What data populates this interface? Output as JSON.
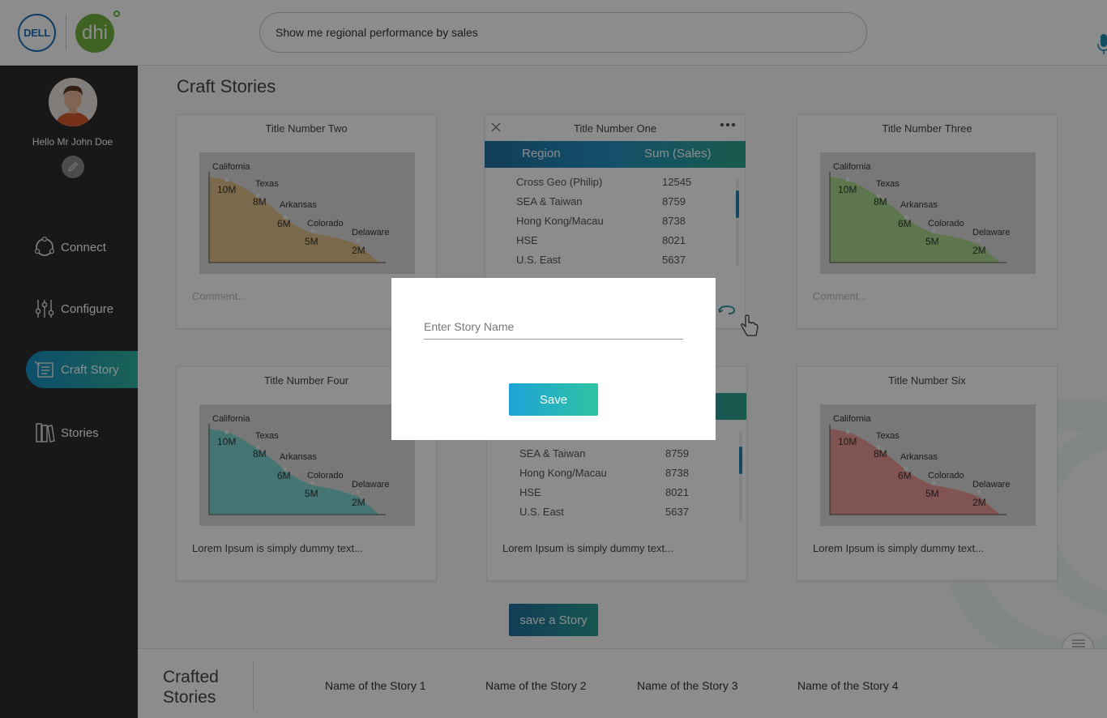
{
  "header": {
    "logos": {
      "dell": "DELL",
      "dhi": "dhi"
    },
    "search": {
      "value": "Show me regional performance by sales",
      "icon": "mic-icon"
    }
  },
  "sidebar": {
    "greeting": "Hello Mr John Doe",
    "nav": [
      {
        "label": "Connect",
        "icon": "connect-icon",
        "active": false
      },
      {
        "label": "Configure",
        "icon": "sliders-icon",
        "active": false
      },
      {
        "label": "Craft Story",
        "icon": "craft-story-icon",
        "active": true
      },
      {
        "label": "Stories",
        "icon": "books-icon",
        "active": false
      }
    ]
  },
  "main": {
    "title": "Craft Stories",
    "chart_labels": {
      "c1": "California",
      "c2": "Texas",
      "c3": "Arkansas",
      "c4": "Colorado",
      "c5": "Delaware",
      "v1": "10M",
      "v2": "8M",
      "v3": "6M",
      "v4": "5M",
      "v5": "2M"
    },
    "cards": [
      {
        "title": "Title Number Two",
        "comment_placeholder": "Comment...",
        "chart_color": "#e0c08a"
      },
      {
        "title": "Title Number One",
        "columns": [
          "Region",
          "Sum (Sales)"
        ],
        "rows": [
          [
            "Cross Geo (Philip)",
            "12545"
          ],
          [
            "SEA & Taiwan",
            "8759"
          ],
          [
            "Hong Kong/Macau",
            "8738"
          ],
          [
            "HSE",
            "8021"
          ],
          [
            "U.S. East",
            "5637"
          ]
        ]
      },
      {
        "title": "Title Number Three",
        "comment_placeholder": "Comment...",
        "chart_color": "#a9d88c"
      },
      {
        "title": "Title Number Four",
        "text": "Lorem Ipsum is simply dummy text...",
        "chart_color": "#7cd6d2"
      },
      {
        "text": "Lorem Ipsum is simply dummy text...",
        "rows": [
          [
            "SEA & Taiwan",
            "8759"
          ],
          [
            "Hong Kong/Macau",
            "8738"
          ],
          [
            "HSE",
            "8021"
          ],
          [
            "U.S. East",
            "5637"
          ]
        ]
      },
      {
        "title": "Title Number Six",
        "text": "Lorem Ipsum is simply dummy text...",
        "chart_color": "#e89a96"
      }
    ],
    "save_story_label": "save a Story"
  },
  "footer": {
    "heading_line1": "Crafted",
    "heading_line2": "Stories",
    "stories": [
      "Name of the Story 1",
      "Name of the Story 2",
      "Name of the Story 3",
      "Name of the Story 4"
    ]
  },
  "modal": {
    "placeholder": "Enter Story Name",
    "save_label": "Save"
  },
  "colors": {
    "accent_start": "#1f6f9e",
    "accent_end": "#2ea58e",
    "sidebar": "#2c2c2c"
  }
}
